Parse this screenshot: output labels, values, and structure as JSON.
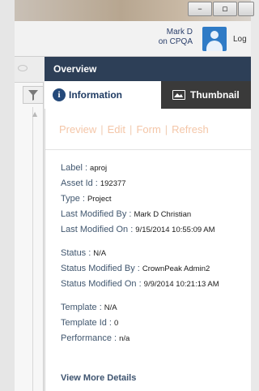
{
  "window": {
    "minimize_glyph": "–",
    "maximize_glyph": "▫"
  },
  "header": {
    "user_name": "Mark D",
    "user_context": "on CPQA",
    "logout_partial": "Log"
  },
  "panel": {
    "title": "Overview",
    "tabs": [
      {
        "label": "Information",
        "icon": "info-icon",
        "active": true
      },
      {
        "label": "Thumbnail",
        "icon": "image-icon",
        "active": false
      }
    ],
    "actions": [
      "Preview",
      "Edit",
      "Form",
      "Refresh"
    ],
    "action_separator": "|",
    "fields_group1": [
      {
        "key": "Label :",
        "value": "aproj"
      },
      {
        "key": "Asset Id :",
        "value": "192377"
      },
      {
        "key": "Type :",
        "value": "Project"
      },
      {
        "key": "Last Modified By :",
        "value": "Mark D Christian"
      },
      {
        "key": "Last Modified On :",
        "value": "9/15/2014 10:55:09 AM"
      }
    ],
    "fields_group2": [
      {
        "key": "Status :",
        "value": "N/A"
      },
      {
        "key": "Status Modified By :",
        "value": "CrownPeak Admin2"
      },
      {
        "key": "Status Modified On :",
        "value": "9/9/2014 10:21:13 AM"
      }
    ],
    "fields_group3": [
      {
        "key": "Template :",
        "value": "N/A"
      },
      {
        "key": "Template Id :",
        "value": "0"
      },
      {
        "key": "Performance :",
        "value": "n/a"
      }
    ],
    "view_more": "View More Details"
  },
  "colors": {
    "panel_bar": "#2d3f57",
    "active_tab_text": "#1f3b63",
    "inactive_tab_bg": "#3a3a3a",
    "action_links": "#f4c6a8",
    "field_key": "#41576f",
    "avatar": "#2f7bc6"
  }
}
